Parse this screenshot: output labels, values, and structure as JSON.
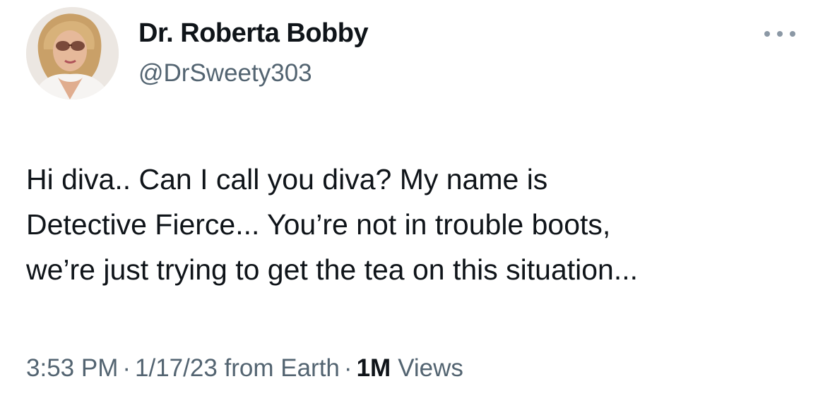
{
  "author": {
    "display_name": "Dr. Roberta Bobby",
    "handle": "@DrSweety303",
    "avatar_icon": "profile-photo"
  },
  "more_icon": "more-horizontal-icon",
  "tweet": {
    "lines": [
      "Hi diva.. Can I call you diva? My name is",
      "Detective Fierce... You’re not in trouble boots,",
      "we’re just trying to get the tea on this situation..."
    ]
  },
  "meta": {
    "time": "3:53 PM",
    "separator": "·",
    "date_source": "1/17/23 from Earth",
    "views_count": "1M",
    "views_label": "Views"
  },
  "colors": {
    "primary_text": "#0f1419",
    "secondary_text": "#536471",
    "background": "#ffffff"
  }
}
